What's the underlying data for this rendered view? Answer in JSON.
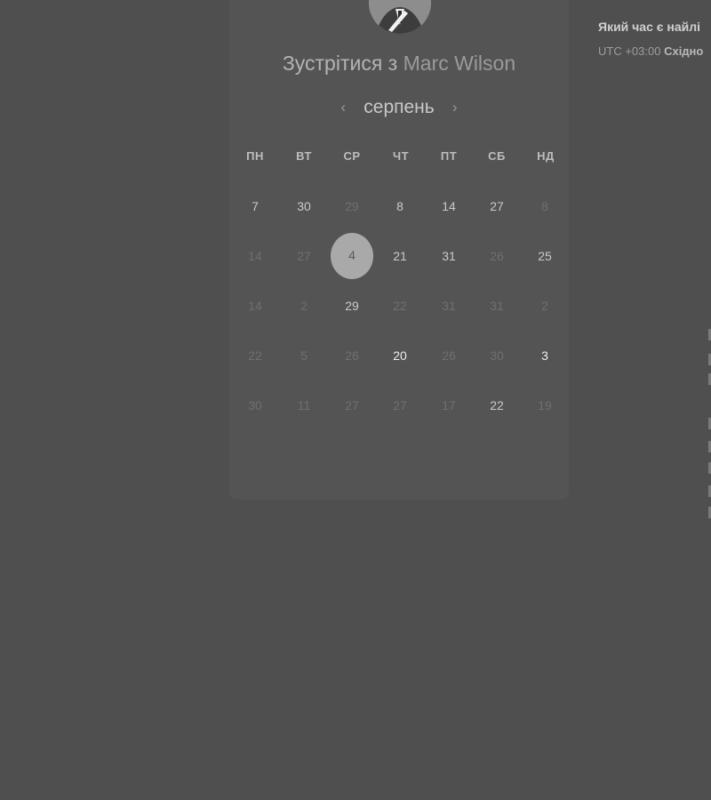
{
  "page": {
    "host_avatar_alt": "",
    "title_prefix": "Зустрітися з",
    "host_name": "Marc Wilson",
    "month": "серпень",
    "nav_prev": "‹",
    "nav_next": "›"
  },
  "weekdays": [
    "ПН",
    "ВТ",
    "СР",
    "ЧТ",
    "ПТ",
    "СБ",
    "НД"
  ],
  "calendar_rows": [
    [
      {
        "label": "7",
        "state": "normal"
      },
      {
        "label": "30",
        "state": "normal"
      },
      {
        "label": "29",
        "state": "faded"
      },
      {
        "label": "8",
        "state": "normal"
      },
      {
        "label": "14",
        "state": "normal"
      },
      {
        "label": "27",
        "state": "normal"
      },
      {
        "label": "8",
        "state": "faded"
      }
    ],
    [
      {
        "label": "14",
        "state": "faded"
      },
      {
        "label": "27",
        "state": "faded"
      },
      {
        "label": "4",
        "state": "selected"
      },
      {
        "label": "21",
        "state": "normal"
      },
      {
        "label": "31",
        "state": "normal"
      },
      {
        "label": "26",
        "state": "faded"
      },
      {
        "label": "25",
        "state": "normal"
      }
    ],
    [
      {
        "label": "14",
        "state": "faded"
      },
      {
        "label": "2",
        "state": "faded"
      },
      {
        "label": "29",
        "state": "normal"
      },
      {
        "label": "22",
        "state": "faded"
      },
      {
        "label": "31",
        "state": "faded"
      },
      {
        "label": "31",
        "state": "faded"
      },
      {
        "label": "2",
        "state": "faded"
      }
    ],
    [
      {
        "label": "22",
        "state": "faded"
      },
      {
        "label": "5",
        "state": "faded"
      },
      {
        "label": "26",
        "state": "faded"
      },
      {
        "label": "20",
        "state": "bright"
      },
      {
        "label": "26",
        "state": "faded"
      },
      {
        "label": "30",
        "state": "faded"
      },
      {
        "label": "3",
        "state": "bright"
      }
    ],
    [
      {
        "label": "30",
        "state": "faded"
      },
      {
        "label": "11",
        "state": "faded"
      },
      {
        "label": "27",
        "state": "faded"
      },
      {
        "label": "27",
        "state": "faded"
      },
      {
        "label": "17",
        "state": "faded"
      },
      {
        "label": "22",
        "state": "normal"
      },
      {
        "label": "19",
        "state": "faded"
      }
    ]
  ],
  "right_panel": {
    "heading": "Який час є найлі",
    "tz_offset": "UTC +03:00",
    "tz_name": "Східно"
  },
  "colors": {
    "overlay": "#4f4f4f",
    "card": "#545454",
    "selected_day": "#a9a9a9"
  }
}
